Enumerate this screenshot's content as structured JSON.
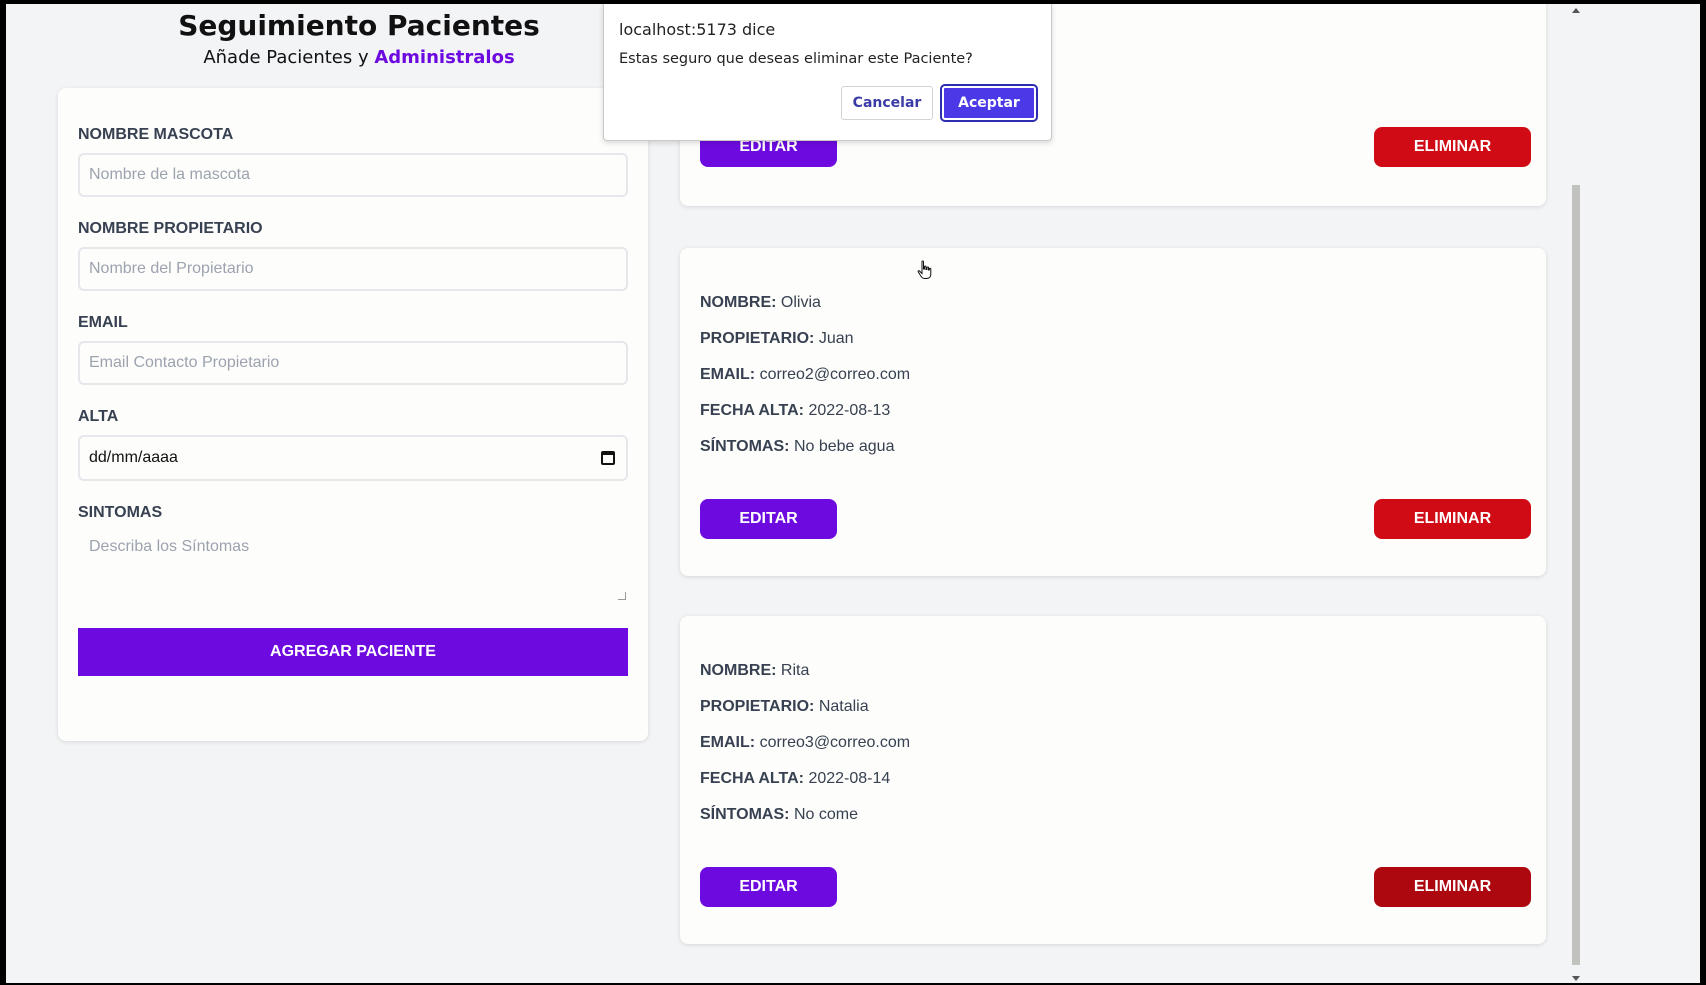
{
  "header": {
    "title": "Seguimiento Pacientes",
    "subtitle_prefix": "Añade Pacientes y ",
    "subtitle_accent": "Administralos"
  },
  "form": {
    "pet_name": {
      "label": "Nombre Mascota",
      "placeholder": "Nombre de la mascota"
    },
    "owner_name": {
      "label": "Nombre Propietario",
      "placeholder": "Nombre del Propietario"
    },
    "email": {
      "label": "Email",
      "placeholder": "Email Contacto Propietario"
    },
    "date": {
      "label": "Alta",
      "value": "dd/mm/aaaa"
    },
    "symptoms": {
      "label": "Sintomas",
      "placeholder": "Describa los Síntomas"
    },
    "submit_label": "Agregar Paciente"
  },
  "patients": [
    {
      "edit_label": "Editar",
      "delete_label": "Eliminar"
    },
    {
      "name_label": "NOMBRE:",
      "name": "Olivia",
      "owner_label": "PROPIETARIO:",
      "owner": "Juan",
      "email_label": "EMAIL:",
      "email": "correo2@correo.com",
      "date_label": "FECHA ALTA:",
      "date": "2022-08-13",
      "symptoms_label": "SÍNTOMAS:",
      "symptoms": "No bebe agua",
      "edit_label": "Editar",
      "delete_label": "Eliminar"
    },
    {
      "name_label": "NOMBRE:",
      "name": "Rita",
      "owner_label": "PROPIETARIO:",
      "owner": "Natalia",
      "email_label": "EMAIL:",
      "email": "correo3@correo.com",
      "date_label": "FECHA ALTA:",
      "date": "2022-08-14",
      "symptoms_label": "SÍNTOMAS:",
      "symptoms": "No come",
      "edit_label": "Editar",
      "delete_label": "Eliminar"
    }
  ],
  "dialog": {
    "origin": "localhost:5173 dice",
    "message": "Estas seguro que deseas eliminar este Paciente?",
    "cancel_label": "Cancelar",
    "accept_label": "Aceptar"
  },
  "colors": {
    "primary": "#6d0ae0",
    "danger": "#d00b15",
    "dialog_accept": "#4b38e6"
  },
  "icons": {
    "calendar": "calendar-icon",
    "cursor": "hand-pointer-icon"
  }
}
